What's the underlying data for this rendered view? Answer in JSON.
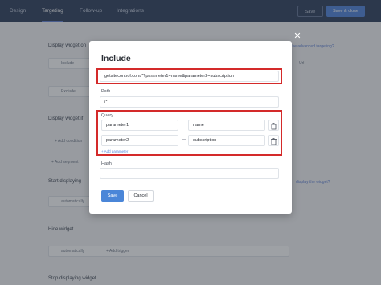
{
  "tabs": [
    {
      "label": "Design"
    },
    {
      "label": "Targeting"
    },
    {
      "label": "Follow-up"
    },
    {
      "label": "Integrations"
    }
  ],
  "toolbar": {
    "save_label": "Save",
    "save_close_label": "Save & close"
  },
  "background": {
    "display_widget_on": "Display widget on",
    "include": "Include",
    "exclude": "Exclude",
    "display_widget_if": "Display widget if",
    "add_condition": "+ Add condition",
    "add_segment": "+ Add segment",
    "start_displaying": "Start displaying",
    "automatically_1": "automatically",
    "hide_widget": "Hide widget",
    "automatically_2": "automatically",
    "stop_displaying": "Stop displaying widget",
    "advanced_link": "Use advanced targeting?",
    "display_link": "display the widget?",
    "add_trigger": "+ Add trigger",
    "url_label": "Url"
  },
  "modal": {
    "title": "Include",
    "url_value": "getsitecontrol.com/*?parameter1=name&parameter2=subscription",
    "path_label": "Path",
    "path_value": "/*",
    "query_label": "Query",
    "query_rows": [
      {
        "key": "parameter1",
        "value": "name"
      },
      {
        "key": "parameter2",
        "value": "subscription"
      }
    ],
    "dash": "—",
    "add_parameter": "+ Add parameter",
    "hash_label": "Hash",
    "hash_value": "",
    "save_label": "Save",
    "cancel_label": "Cancel"
  },
  "colors": {
    "accent": "#4a86d8",
    "highlight": "#d42a2a",
    "topbar": "#3b4a66"
  }
}
